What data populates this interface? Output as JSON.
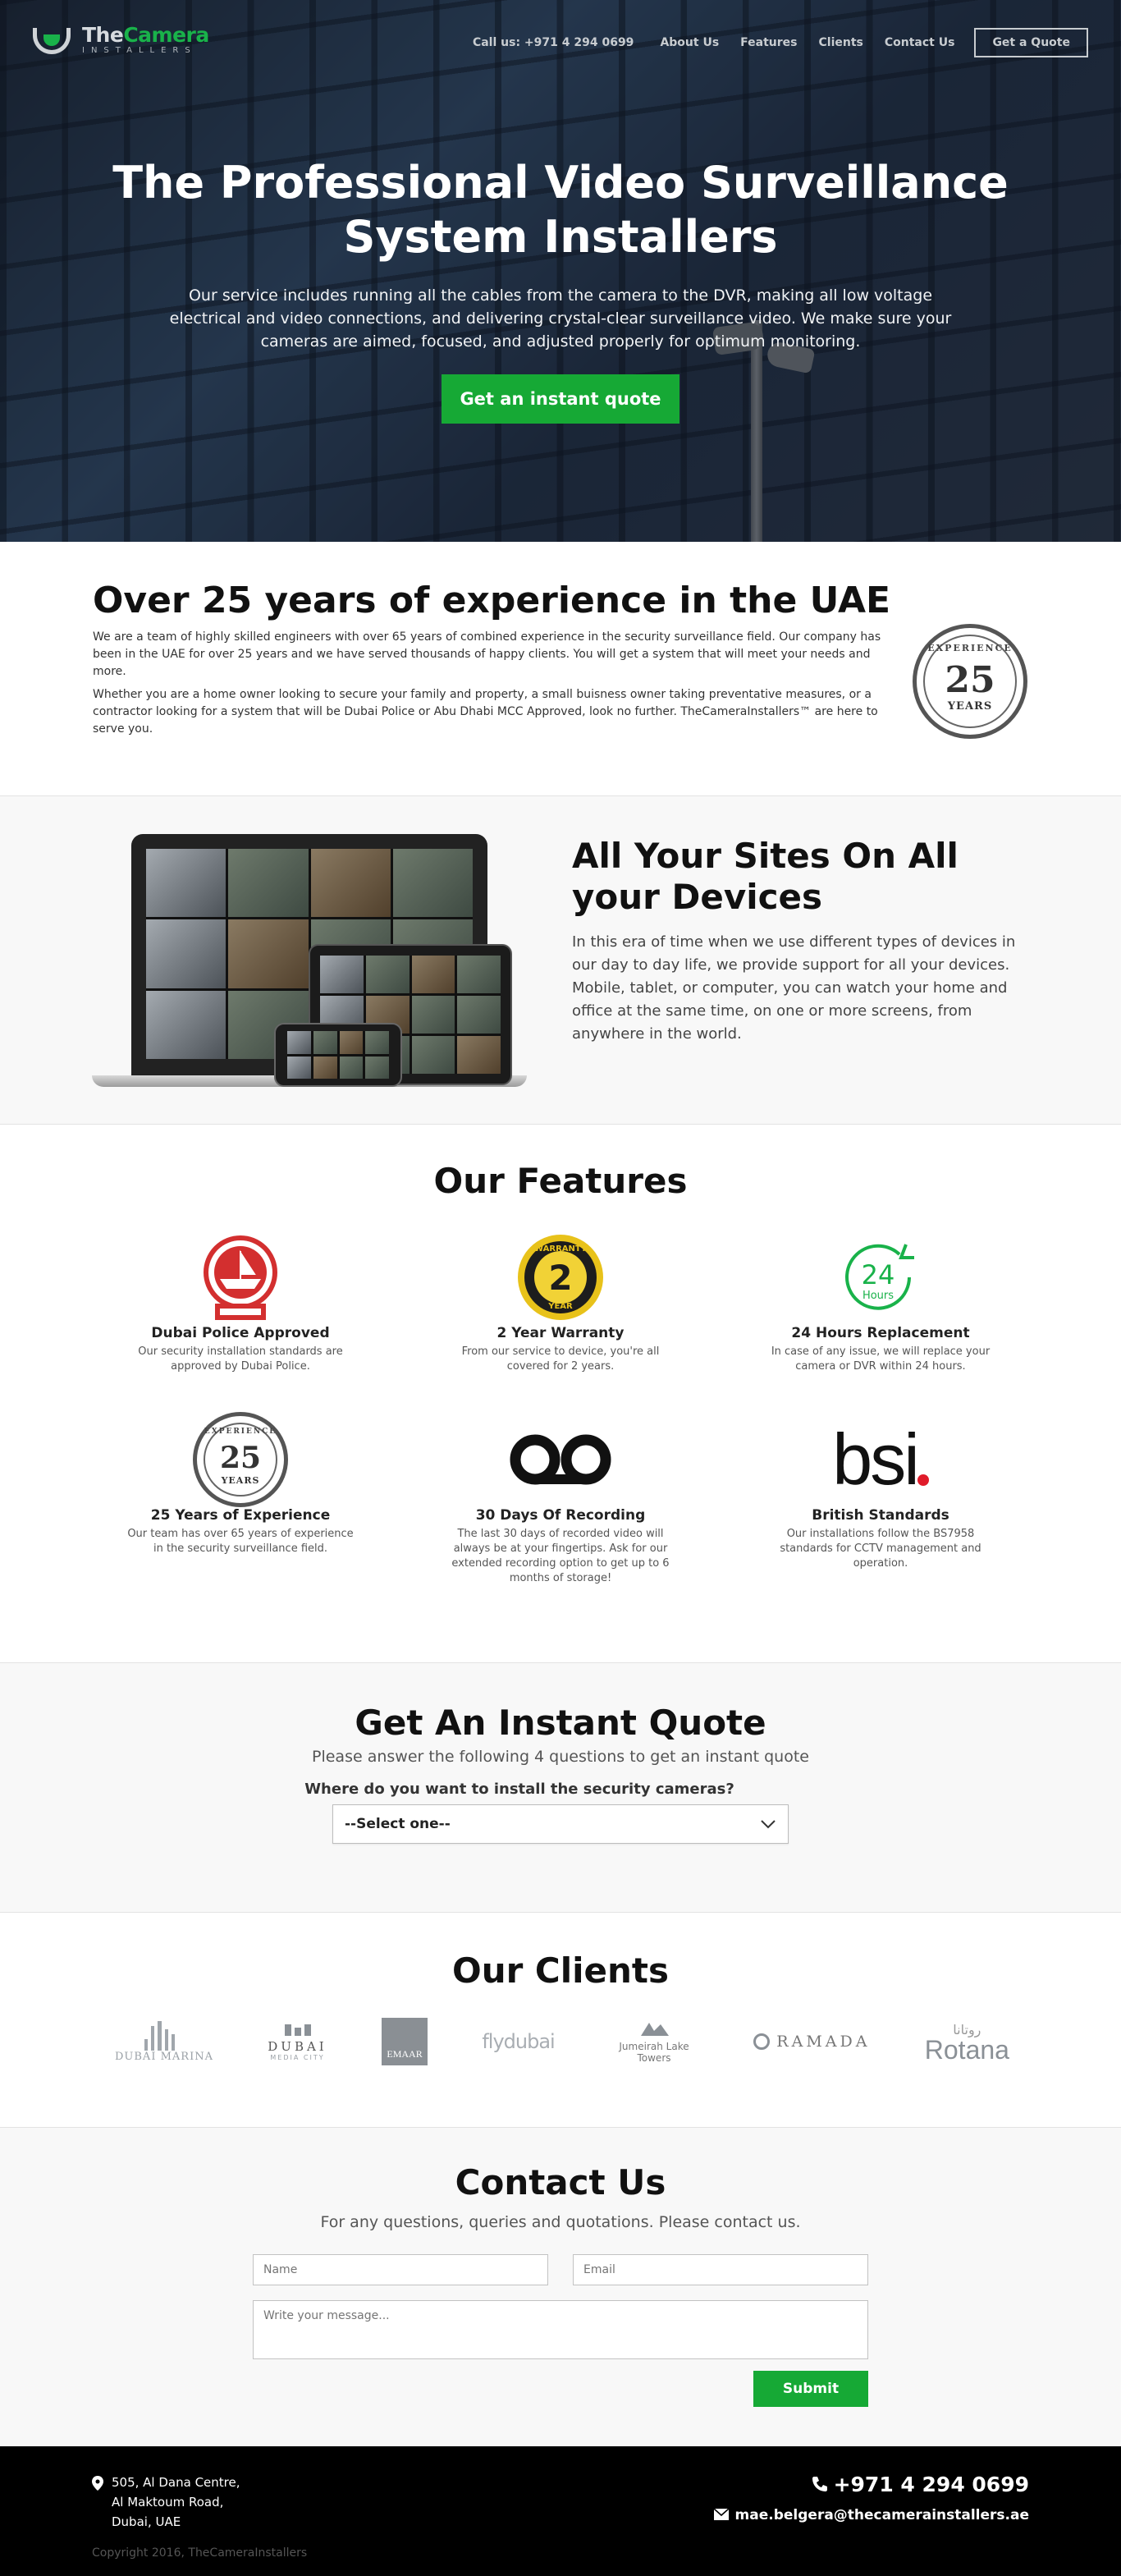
{
  "brand": {
    "name_part1": "The",
    "name_part2": "Camera",
    "tagline": "INSTALLERS"
  },
  "nav": {
    "phone": "Call us: +971 4 294 0699",
    "links": [
      "About Us",
      "Features",
      "Clients",
      "Contact Us"
    ],
    "quote_button": "Get a Quote"
  },
  "hero": {
    "title": "The Professional Video Surveillance System Installers",
    "text": "Our service includes running all the cables from the camera to the DVR, making all low voltage electrical and video connections, and delivering crystal-clear surveillance video. We make sure your cameras are aimed, focused, and adjusted properly for optimum monitoring.",
    "cta": "Get an instant quote"
  },
  "experience": {
    "title": "Over 25 years of experience in the UAE",
    "p1": "We are a team of highly skilled engineers with over 65 years of combined experience in the security surveillance field. Our company has been in the UAE for over 25 years and we have served thousands of happy clients. You will get a system that will meet your needs and more.",
    "p2": "Whether you are a home owner looking to secure your family and property, a small buisness owner taking preventative measures, or a contractor looking for a system that will be Dubai Police or Abu Dhabi MCC Approved, look no further. TheCameraInstallers™ are here to serve you.",
    "badge": {
      "top": "EXPERIENCE",
      "number": "25",
      "bottom": "YEARS"
    }
  },
  "devices": {
    "title": "All Your Sites On All your Devices",
    "text": "In this era of time when we use different types of devices in our day to day life, we provide support for all your devices. Mobile, tablet, or computer, you can watch your home and office at the same time, on one or more screens, from anywhere in the world."
  },
  "features": {
    "title": "Our Features",
    "items": [
      {
        "title": "Dubai Police Approved",
        "desc": "Our security installation standards are approved by Dubai Police.",
        "icon": "police-emblem-icon"
      },
      {
        "title": "2 Year Warranty",
        "desc": "From our service to device, you're all covered for 2 years.",
        "icon": "warranty-badge-icon",
        "badge_num": "2",
        "badge_top": "WARRANTY",
        "badge_bottom": "YEAR"
      },
      {
        "title": "24 Hours Replacement",
        "desc": "In case of any issue, we will replace your camera or DVR within 24 hours.",
        "icon": "24-hours-icon",
        "badge_num": "24",
        "badge_sub": "Hours"
      },
      {
        "title": "25 Years of Experience",
        "desc": "Our team has over 65 years of experience in the security surveillance field.",
        "icon": "experience-stamp-icon"
      },
      {
        "title": "30 Days Of Recording",
        "desc": "The last 30 days of recorded video will always be at your fingertips. Ask for our extended recording option to get up to 6 months of storage!",
        "icon": "recording-tape-icon"
      },
      {
        "title": "British Standards",
        "desc": "Our installations follow the BS7958 standards for CCTV management and operation.",
        "icon": "bsi-logo-icon",
        "logo_text": "bsi"
      }
    ]
  },
  "quote": {
    "title": "Get An Instant Quote",
    "subtitle": "Please answer the following 4 questions to get an instant quote",
    "question": "Where do you want to install the security cameras?",
    "select_value": "--Select one--"
  },
  "clients": {
    "title": "Our Clients",
    "logos": [
      "DUBAI MARINA",
      "DUBAI",
      "EMAAR",
      "flydubai",
      "Jumeirah Lake Towers",
      "RAMADA",
      "Rotana"
    ],
    "dubai_sub": "MEDIA CITY",
    "rotana_arabic": "روتانا"
  },
  "contact": {
    "title": "Contact Us",
    "subtitle": "For any questions, queries and quotations. Please contact us.",
    "name_placeholder": "Name",
    "email_placeholder": "Email",
    "message_placeholder": "Write your message...",
    "submit": "Submit"
  },
  "footer": {
    "address": [
      "505, Al Dana Centre,",
      "Al Maktoum Road,",
      "Dubai, UAE"
    ],
    "phone": "+971 4 294 0699",
    "email": "mae.belgera@thecamerainstallers.ae",
    "copyright": "Copyright 2016, TheCameraInstallers"
  },
  "colors": {
    "accent": "#16a935",
    "dark": "#000000",
    "badge_red": "#d32f2f",
    "badge_gold": "#e8c21a"
  }
}
